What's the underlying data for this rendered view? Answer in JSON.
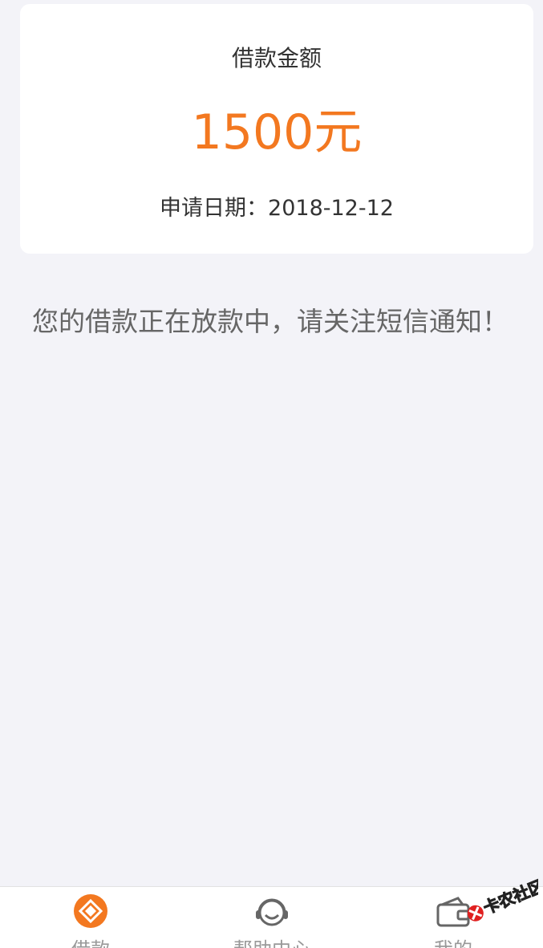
{
  "loan_card": {
    "label": "借款金额",
    "amount": "1500元",
    "date_text": "申请日期：2018-12-12"
  },
  "notice": "您的借款正在放款中，请关注短信通知！",
  "tabbar": {
    "items": [
      {
        "label": "借款",
        "icon": "loan-icon",
        "active": true
      },
      {
        "label": "帮助中心",
        "icon": "headset-icon",
        "active": false
      },
      {
        "label": "我的",
        "icon": "wallet-icon",
        "active": false
      }
    ]
  },
  "watermark": {
    "text": "卡农社区"
  },
  "colors": {
    "accent": "#f37820",
    "background": "#f3f3f8",
    "card": "#ffffff",
    "text_primary": "#333333",
    "text_secondary": "#666666",
    "tab_inactive": "#999999"
  }
}
